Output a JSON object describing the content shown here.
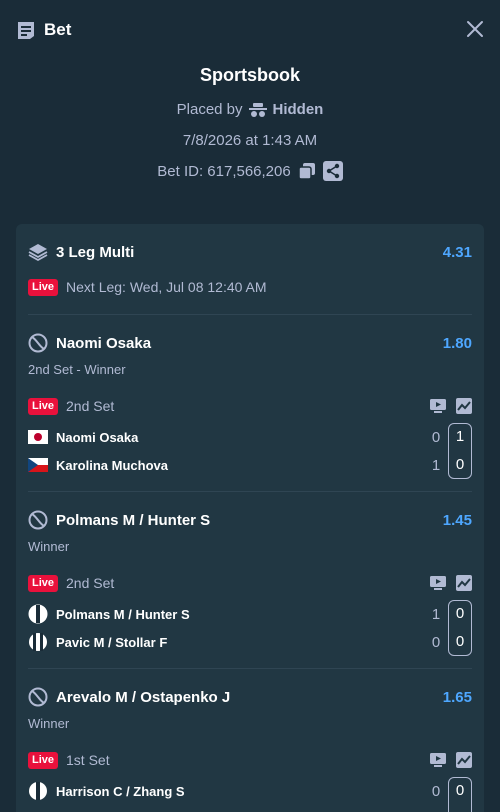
{
  "header": {
    "title": "Bet",
    "receipt_icon": "receipt-icon",
    "close_icon": "close-icon"
  },
  "info": {
    "brand": "Sportsbook",
    "placed_by_label": "Placed by",
    "placed_by_user": "Hidden",
    "datetime": "7/8/2026 at 1:43 AM",
    "bet_id": "Bet ID: 617,566,206"
  },
  "multi": {
    "label": "3 Leg Multi",
    "odds": "4.31",
    "live": "Live",
    "next_leg": "Next Leg: Wed, Jul 08 12:40 AM"
  },
  "legs": [
    {
      "name": "Naomi Osaka",
      "odds": "1.80",
      "market": "2nd Set - Winner",
      "live": "Live",
      "set": "2nd Set",
      "players": [
        {
          "name": "Naomi Osaka",
          "games": "0",
          "set": "1"
        },
        {
          "name": "Karolina Muchova",
          "games": "1",
          "set": "0"
        }
      ]
    },
    {
      "name": "Polmans M / Hunter S",
      "odds": "1.45",
      "market": "Winner",
      "live": "Live",
      "set": "2nd Set",
      "players": [
        {
          "name": "Polmans M / Hunter S",
          "games": "1",
          "set": "0"
        },
        {
          "name": "Pavic M / Stollar F",
          "games": "0",
          "set": "0"
        }
      ]
    },
    {
      "name": "Arevalo M / Ostapenko J",
      "odds": "1.65",
      "market": "Winner",
      "live": "Live",
      "set": "1st Set",
      "players": [
        {
          "name": "Harrison C / Zhang S",
          "games": "0",
          "set": "0"
        }
      ]
    }
  ],
  "colors": {
    "background": "#1a2c38",
    "card": "#213743",
    "odds": "#4ea7ff",
    "live": "#e9113c",
    "muted": "#b1bad3"
  }
}
